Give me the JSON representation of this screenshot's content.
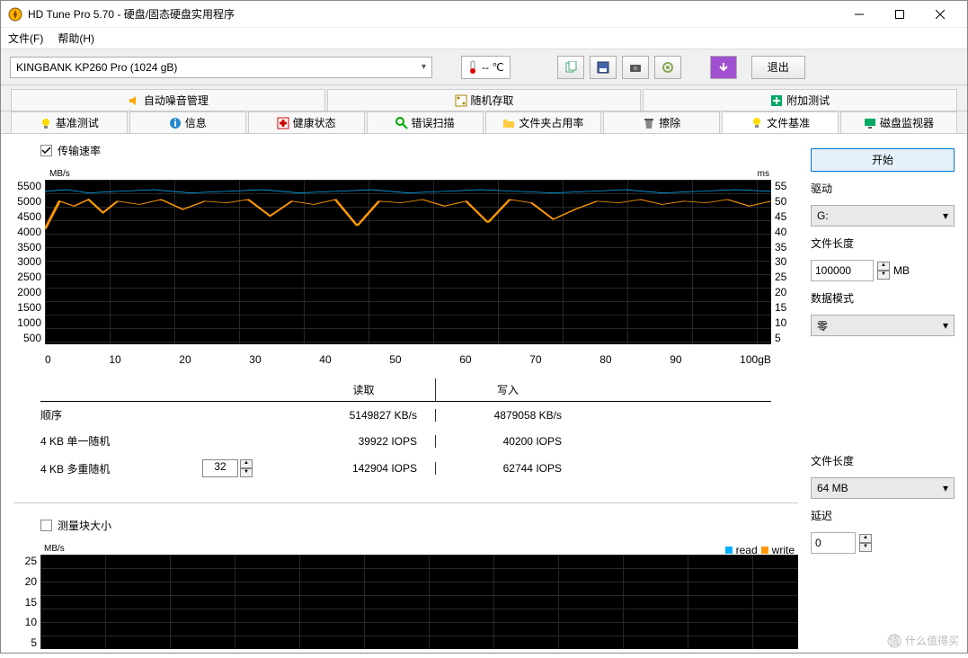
{
  "window": {
    "title": "HD Tune Pro 5.70 - 硬盘/固态硬盘实用程序"
  },
  "menu": {
    "file": "文件(F)",
    "help": "帮助(H)"
  },
  "toolbar": {
    "drive": "KINGBANK KP260 Pro (1024 gB)",
    "temp": "-- ℃",
    "exit": "退出"
  },
  "tabs_upper": [
    {
      "label": "自动噪音管理"
    },
    {
      "label": "随机存取"
    },
    {
      "label": "附加测试"
    }
  ],
  "tabs_lower": [
    {
      "label": "基准测试"
    },
    {
      "label": "信息"
    },
    {
      "label": "健康状态"
    },
    {
      "label": "错误扫描"
    },
    {
      "label": "文件夹占用率"
    },
    {
      "label": "擦除"
    },
    {
      "label": "文件基准",
      "active": true
    },
    {
      "label": "磁盘监视器"
    }
  ],
  "transfer": {
    "checkbox_label": "传输速率",
    "unit_left": "MB/s",
    "unit_right": "ms",
    "yticks_left": [
      "5500",
      "5000",
      "4500",
      "4000",
      "3500",
      "3000",
      "2500",
      "2000",
      "1500",
      "1000",
      "500"
    ],
    "yticks_right": [
      "55",
      "50",
      "45",
      "40",
      "35",
      "30",
      "25",
      "20",
      "15",
      "10",
      "5"
    ],
    "xticks": [
      "0",
      "10",
      "20",
      "30",
      "40",
      "50",
      "60",
      "70",
      "80",
      "90",
      "100gB"
    ]
  },
  "results": {
    "header_read": "读取",
    "header_write": "写入",
    "rows": [
      {
        "label": "顺序",
        "read": "5149827 KB/s",
        "write": "4879058 KB/s"
      },
      {
        "label": "4 KB 单一随机",
        "read": "39922 IOPS",
        "write": "40200 IOPS"
      },
      {
        "label": "4 KB 多重随机",
        "spinner": "32",
        "read": "142904 IOPS",
        "write": "62744 IOPS"
      }
    ]
  },
  "blocksize": {
    "checkbox_label": "测量块大小",
    "unit_left": "MB/s",
    "yticks": [
      "25",
      "20",
      "15",
      "10",
      "5"
    ],
    "legend_read": "read",
    "legend_write": "write"
  },
  "sidebar": {
    "start": "开始",
    "drive_label": "驱动",
    "drive_value": "G:",
    "filelen_label": "文件长度",
    "filelen_value": "100000",
    "filelen_unit": "MB",
    "datamode_label": "数据模式",
    "datamode_value": "零",
    "filelen2_label": "文件长度",
    "filelen2_value": "64 MB",
    "delay_label": "延迟",
    "delay_value": "0"
  },
  "chart_data": {
    "type": "line",
    "title": "传输速率",
    "xlabel": "gB",
    "ylabel": "MB/s",
    "xlim": [
      0,
      100
    ],
    "ylim_left": [
      0,
      5500
    ],
    "ylim_right": [
      0,
      55
    ],
    "series": [
      {
        "name": "read (MB/s)",
        "color": "#00b0ff",
        "approx_range": [
          4900,
          5200
        ]
      },
      {
        "name": "write (MB/s)",
        "color": "#ff9800",
        "approx_range": [
          3800,
          5000
        ]
      }
    ],
    "note": "Lines fluctuate densely across full x range; read stays near 5000-5200, write mostly 4600-4900 with dips to ~3800-4200."
  },
  "watermark": "什么值得买"
}
